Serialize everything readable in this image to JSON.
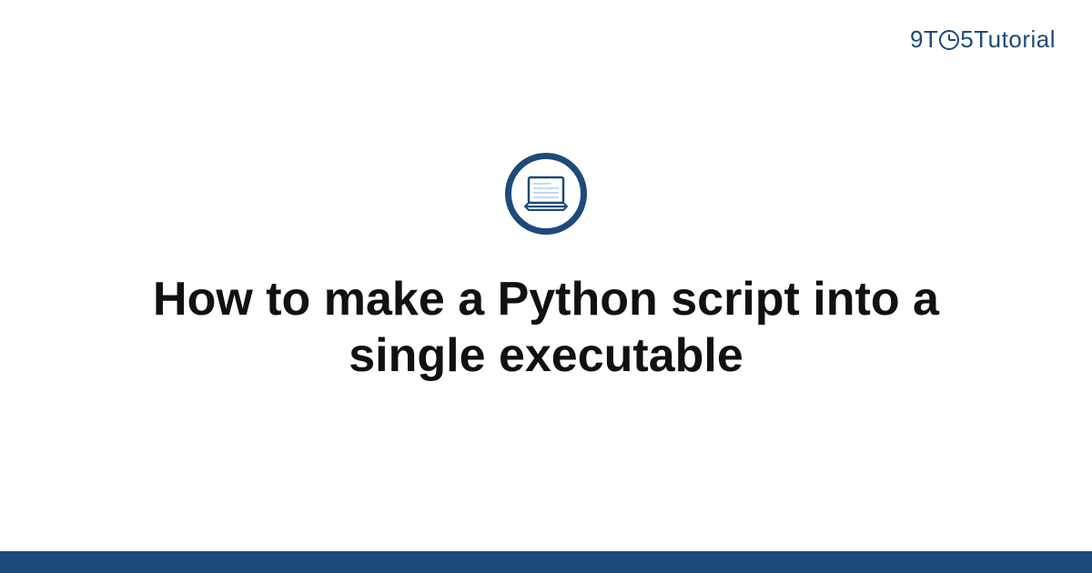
{
  "brand": {
    "prefix": "9T",
    "suffix": "5",
    "name": "Tutorial"
  },
  "page": {
    "title": "How to make a Python script into a single executable"
  },
  "icon": {
    "name": "laptop-icon"
  },
  "colors": {
    "primary": "#1e4a7a",
    "light": "#c5d9ed",
    "text": "#111111"
  }
}
